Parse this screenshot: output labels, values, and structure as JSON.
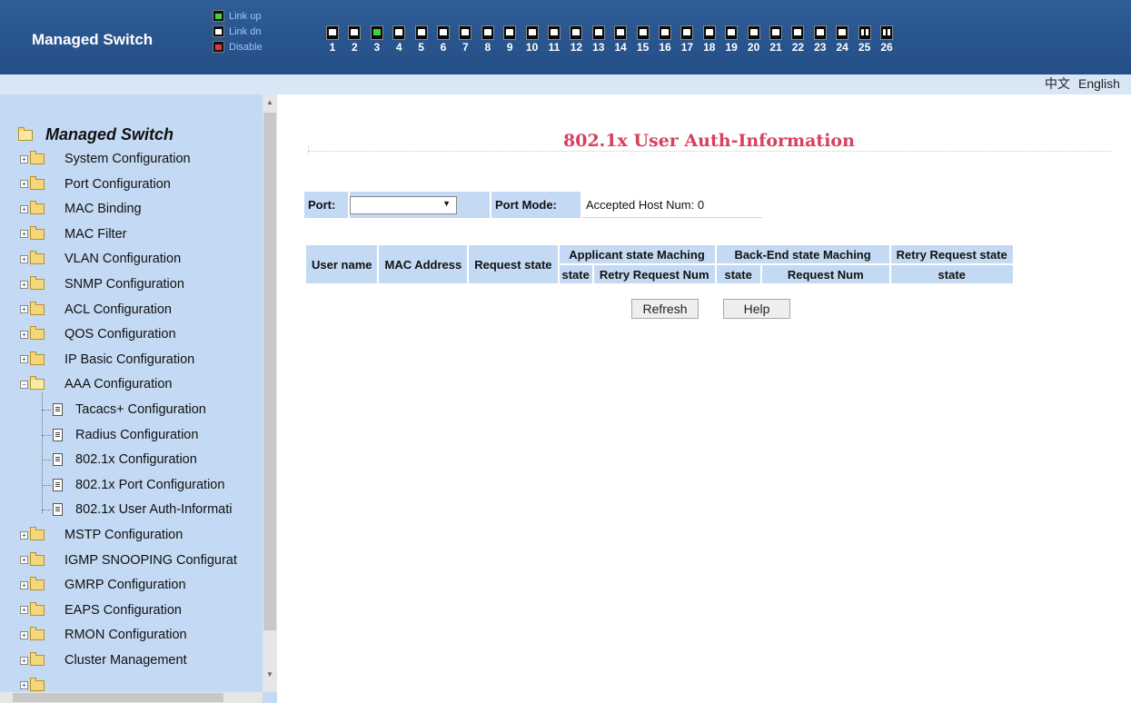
{
  "header": {
    "brand": "Managed Switch",
    "legend": [
      "Link up",
      "Link dn",
      "Disable"
    ],
    "ports": [
      {
        "num": "1",
        "status": "down"
      },
      {
        "num": "2",
        "status": "down"
      },
      {
        "num": "3",
        "status": "up"
      },
      {
        "num": "4",
        "status": "down"
      },
      {
        "num": "5",
        "status": "down"
      },
      {
        "num": "6",
        "status": "down"
      },
      {
        "num": "7",
        "status": "down"
      },
      {
        "num": "8",
        "status": "down"
      },
      {
        "num": "9",
        "status": "down"
      },
      {
        "num": "10",
        "status": "down"
      },
      {
        "num": "11",
        "status": "down"
      },
      {
        "num": "12",
        "status": "down"
      },
      {
        "num": "13",
        "status": "down"
      },
      {
        "num": "14",
        "status": "down"
      },
      {
        "num": "15",
        "status": "down"
      },
      {
        "num": "16",
        "status": "down"
      },
      {
        "num": "17",
        "status": "down"
      },
      {
        "num": "18",
        "status": "down"
      },
      {
        "num": "19",
        "status": "down"
      },
      {
        "num": "20",
        "status": "down"
      },
      {
        "num": "21",
        "status": "down"
      },
      {
        "num": "22",
        "status": "down"
      },
      {
        "num": "23",
        "status": "down"
      },
      {
        "num": "24",
        "status": "down"
      },
      {
        "num": "25",
        "status": "down-combo"
      },
      {
        "num": "26",
        "status": "down-combo"
      }
    ],
    "colors": {
      "bar": "#2f5d97",
      "link_up": "#3cd63c",
      "disable": "#e33"
    }
  },
  "lang": {
    "chinese": "中文",
    "english": "English"
  },
  "sidebar": {
    "root": "Managed Switch",
    "items": [
      "System Configuration",
      "Port Configuration",
      "MAC Binding",
      "MAC Filter",
      "VLAN Configuration",
      "SNMP Configuration",
      "ACL Configuration",
      "QOS Configuration",
      "IP Basic Configuration",
      "AAA Configuration"
    ],
    "aaa_children": [
      "Tacacs+ Configuration",
      "Radius Configuration",
      "802.1x Configuration",
      "802.1x Port Configuration",
      "802.1x User Auth-Informati"
    ],
    "items_after": [
      "MSTP Configuration",
      "IGMP SNOOPING Configurat",
      "GMRP Configuration",
      "EAPS Configuration",
      "RMON Configuration",
      "Cluster Management"
    ],
    "expander_closed": "+",
    "expander_open": "−"
  },
  "main": {
    "title": "802.1x User Auth-Information",
    "port_label": "Port:",
    "port_value": "",
    "port_mode_label": "Port Mode:",
    "accepted_host": "Accepted Host Num: 0",
    "table": {
      "user_name": "User name",
      "mac_address": "MAC Address",
      "request_state": "Request state",
      "applicant_group": "Applicant state Maching",
      "backend_group": "Back-End state Maching",
      "retry_group": "Retry Request state",
      "applicant_state": "state",
      "applicant_retry": "Retry Request Num",
      "backend_state": "state",
      "backend_request": "Request Num",
      "retry_state": "state"
    },
    "buttons": {
      "refresh": "Refresh",
      "help": "Help"
    }
  }
}
